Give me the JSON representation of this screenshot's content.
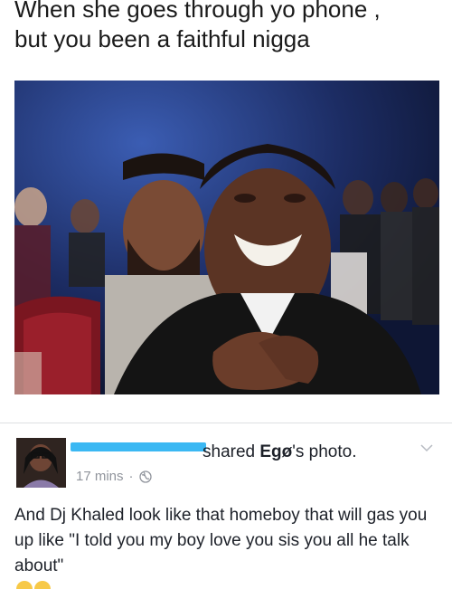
{
  "meme": {
    "caption": "When she goes through yo phone ,\nbut you been a faithful nigga"
  },
  "post": {
    "action_text": "shared ",
    "owner_name": "Egø",
    "owner_suffix": "'s photo.",
    "time": "17 mins",
    "separator": "·",
    "privacy_icon": "globe-icon",
    "menu_icon": "chevron-down-icon",
    "body": "And Dj Khaled look like that homeboy that will gas you up like \"I told you my boy love you sis you all he talk about\""
  },
  "colors": {
    "redaction": "#3bb8f3",
    "meta_gray": "#90949c",
    "text": "#1d2129"
  }
}
